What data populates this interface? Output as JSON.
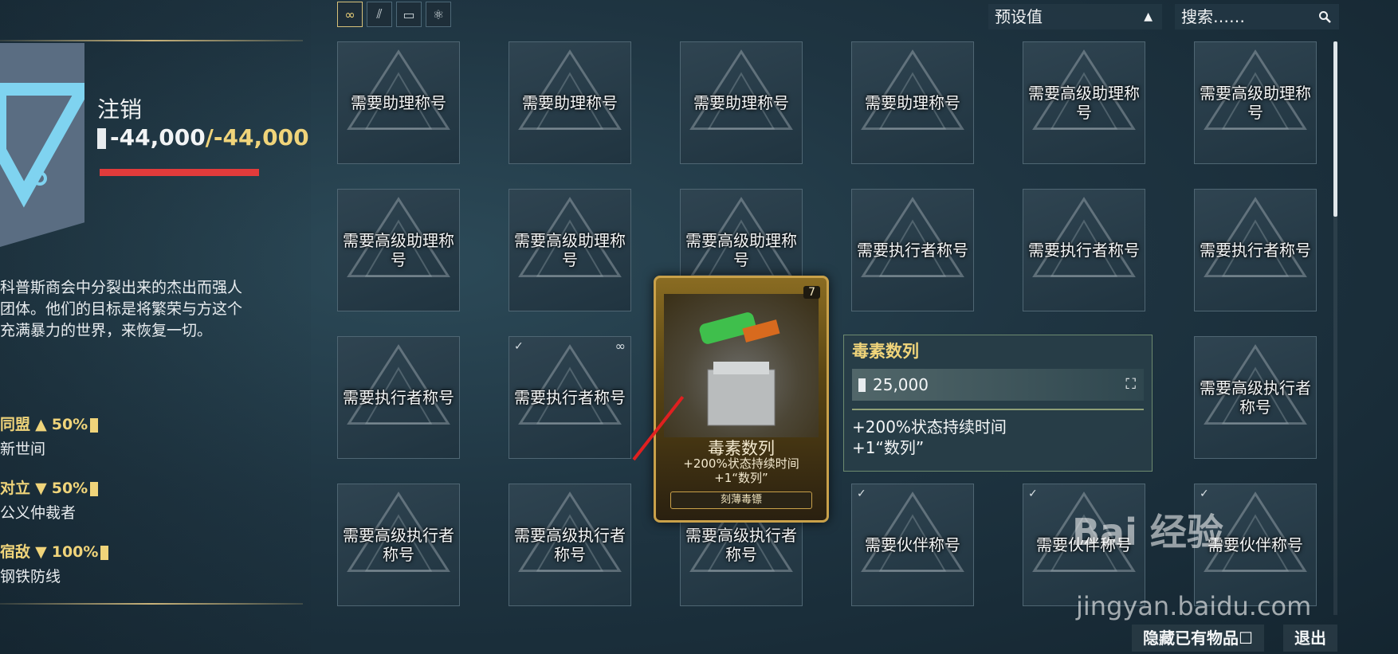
{
  "faction": {
    "name": "注销",
    "standing_current": "-44,000",
    "standing_separator": "/",
    "standing_max": "-44,000",
    "description": "科普斯商会中分裂出来的杰出而强人团体。他们的目标是将繁荣与方这个充满暴力的世界，来恢复一切。",
    "relations": [
      {
        "label": "同盟",
        "direction": "▲",
        "percent": "50%",
        "faction": "新世间"
      },
      {
        "label": "对立",
        "direction": "▼",
        "percent": "50%",
        "faction": "公义仲裁者"
      },
      {
        "label": "宿敌",
        "direction": "▼",
        "percent": "100%",
        "faction": "钢铁防线"
      }
    ]
  },
  "toolbar": {
    "filters": [
      {
        "icon": "infinity-icon",
        "glyph": "∞",
        "active": true
      },
      {
        "icon": "stripes-icon",
        "glyph": "⫽"
      },
      {
        "icon": "card-icon",
        "glyph": "▭"
      },
      {
        "icon": "atom-icon",
        "glyph": "⚛"
      }
    ],
    "preset_label": "预设值",
    "preset_arrow": "▲",
    "search_placeholder": "搜索……",
    "search_icon": "🔍"
  },
  "grid": {
    "rows": [
      [
        "需要助理称号",
        "需要助理称号",
        "需要助理称号",
        "需要助理称号",
        "需要高级助理称号",
        "需要高级助理称号"
      ],
      [
        "需要高级助理称号",
        "需要高级助理称号",
        "需要高级助理称号",
        "需要执行者称号",
        "需要执行者称号",
        "需要执行者称号"
      ],
      [
        "需要执行者称号",
        "需要执行者称号",
        "",
        "",
        "",
        "需要高级执行者称号"
      ],
      [
        "需要高级执行者称号",
        "需要高级执行者称号",
        "需要高级执行者称号",
        "需要伙伴称号",
        "需要伙伴称号",
        "需要伙伴称号"
      ]
    ]
  },
  "mod_card": {
    "rank": "7",
    "name": "毒素数列",
    "stat1": "+200%状态持续时间",
    "stat2": "+1“数列”",
    "set_name": "刻薄毒镖"
  },
  "info_panel": {
    "title": "毒素数列",
    "price": "25,000",
    "stat1": "+200%状态持续时间",
    "stat2": "+1“数列”"
  },
  "footer": {
    "hide_owned": "隐藏已有物品☐",
    "exit": "退出"
  },
  "watermark": {
    "text": "Bai 经验",
    "sub": "jingyan.baidu.com"
  },
  "colors": {
    "accent": "#f0d47a",
    "standing_bar": "#e13b3b",
    "frame": "#4f6673"
  }
}
